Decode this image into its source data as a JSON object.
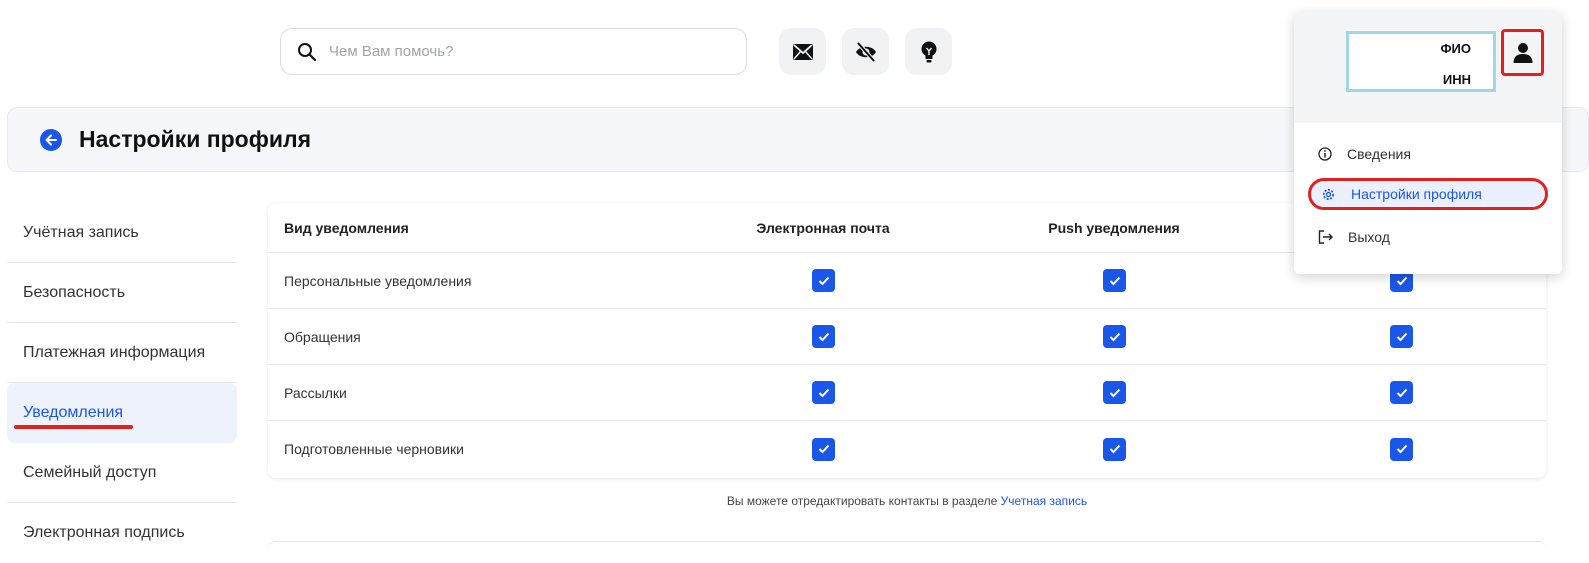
{
  "search": {
    "placeholder": "Чем Вам помочь?"
  },
  "top_icons": [
    "mail-icon",
    "eye-off-icon",
    "lightbulb-icon"
  ],
  "header": {
    "title": "Настройки профиля"
  },
  "sidebar": {
    "items": [
      {
        "label": "Учётная запись",
        "active": false
      },
      {
        "label": "Безопасность",
        "active": false
      },
      {
        "label": "Платежная информация",
        "active": false
      },
      {
        "label": "Уведомления",
        "active": true
      },
      {
        "label": "Семейный доступ",
        "active": false
      },
      {
        "label": "Электронная подпись",
        "active": false
      }
    ]
  },
  "table": {
    "headers": [
      "Вид уведомления",
      "Электронная почта",
      "Push уведомления",
      ""
    ],
    "rows": [
      {
        "label": "Персональные уведомления",
        "email": true,
        "push": true,
        "third": true
      },
      {
        "label": "Обращения",
        "email": true,
        "push": true,
        "third": true
      },
      {
        "label": "Рассылки",
        "email": true,
        "push": true,
        "third": true
      },
      {
        "label": "Подготовленные черновики",
        "email": true,
        "push": true,
        "third": true
      }
    ]
  },
  "note": {
    "text": "Вы можете отредактировать контакты в разделе",
    "link": "Учетная запись"
  },
  "dropdown": {
    "fio_label": "ФИО",
    "inn_label": "ИНН",
    "items": [
      {
        "label": "Сведения",
        "icon": "info-icon"
      },
      {
        "label": "Настройки профиля",
        "icon": "gear-icon"
      },
      {
        "label": "Выход",
        "icon": "logout-icon"
      }
    ]
  },
  "colors": {
    "accent": "#1a56e8",
    "highlight": "#e0211d",
    "userbox_border": "#9fd7e5"
  }
}
